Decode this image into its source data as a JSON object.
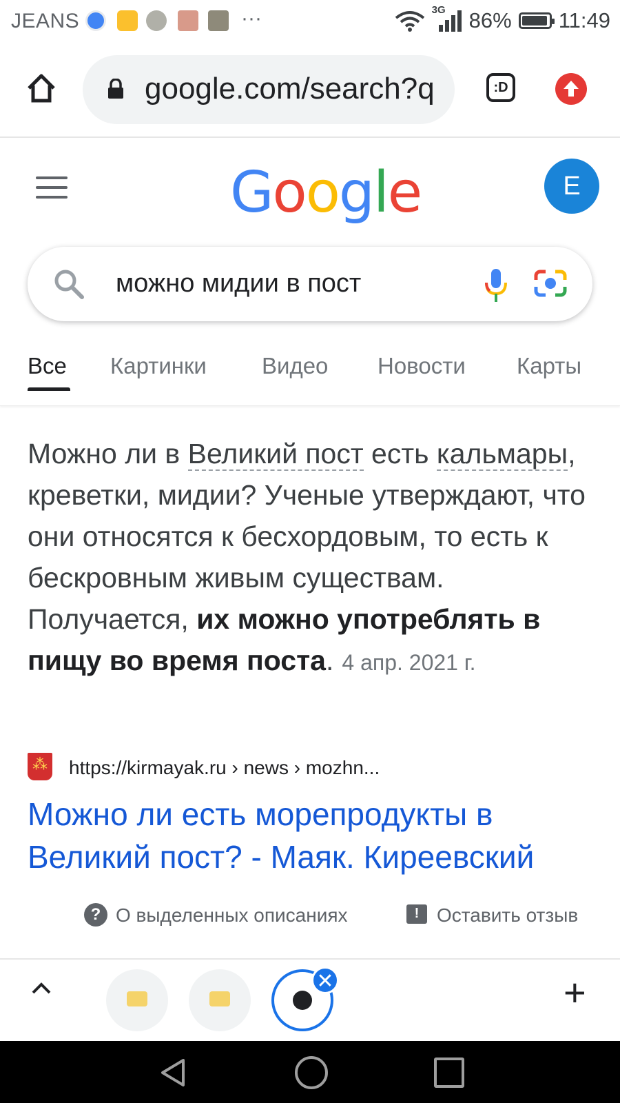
{
  "status_bar": {
    "carrier": "JEANS",
    "overflow": "···",
    "network": "3G",
    "battery": "86%",
    "time": "11:49"
  },
  "browser": {
    "url": "google.com/search?q",
    "tab_switcher_label": ":D"
  },
  "header": {
    "logo": "Google",
    "avatar_letter": "E"
  },
  "search": {
    "query": "можно мидии в пост"
  },
  "tabs": [
    {
      "label": "Все",
      "active": true
    },
    {
      "label": "Картинки",
      "active": false
    },
    {
      "label": "Видео",
      "active": false
    },
    {
      "label": "Новости",
      "active": false
    },
    {
      "label": "Карты",
      "active": false
    }
  ],
  "snippet": {
    "part1": "Можно ли в ",
    "link1": "Великий пост",
    "part2": " есть ",
    "link2": "кальмары",
    "part3": ", креветки, мидии? Ученые утверждают, что они относятся к бесхордовым, то есть к бескровным живым существам. Получается, ",
    "bold": "их можно употреблять в пищу во время поста",
    "end": ".",
    "date": "4 апр. 2021 г."
  },
  "source": {
    "url": "https://kirmayak.ru › news › mozhn...",
    "title": "Можно ли есть морепродукты в Великий пост? - Маяк. Киреевский"
  },
  "footer": {
    "about": "О выделенных описаниях",
    "feedback": "Оставить отзыв"
  },
  "tab_strip": {
    "close": "✕",
    "new_tab": "+"
  },
  "colors": {
    "link": "#1558d6",
    "accent": "#1a73e8",
    "avatar": "#1a84d8"
  }
}
